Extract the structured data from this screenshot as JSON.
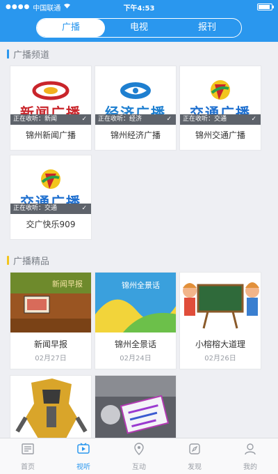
{
  "status_bar": {
    "signal_dots": "●●●●",
    "carrier": "中国联通",
    "time": "下午4:53",
    "battery_level": 0.9
  },
  "top_tabs": [
    {
      "label": "广播",
      "active": true
    },
    {
      "label": "电视",
      "active": false
    },
    {
      "label": "报刊",
      "active": false
    }
  ],
  "sections": {
    "channels_title": "广播频道",
    "programs_title": "广播精品"
  },
  "channels": [
    {
      "logo_text": "新闻广播",
      "strip_text": "正在收听：新闻",
      "name": "锦州新闻广播",
      "logo_color": "#c9252b",
      "icon": "news-broadcast-logo-icon"
    },
    {
      "logo_text": "经济广播",
      "strip_text": "正在收听：经济",
      "name": "锦州经济广播",
      "logo_color": "#1e7fd0",
      "icon": "economy-broadcast-logo-icon"
    },
    {
      "logo_text": "交通广播",
      "strip_text": "正在收听：交通",
      "name": "锦州交通广播",
      "logo_color": "#c9252b",
      "icon": "traffic-broadcast-logo-icon"
    },
    {
      "logo_text": "交通广播",
      "strip_text": "正在收听：交通",
      "name": "交广快乐909",
      "logo_color": "#1e6fcf",
      "icon": "traffic-broadcast-logo-icon"
    }
  ],
  "programs": [
    {
      "name": "新闻早报",
      "date": "02月27日",
      "thumb": "news-morning-thumb"
    },
    {
      "name": "锦州全景话",
      "date": "02月24日",
      "thumb": "landscape-thumb"
    },
    {
      "name": "小榕榕大道理",
      "date": "02月26日",
      "thumb": "kids-thumb"
    },
    {
      "name": "",
      "date": "",
      "thumb": "robot-thumb"
    },
    {
      "name": "",
      "date": "",
      "thumb": "sign-thumb"
    }
  ],
  "bottom_tabs": [
    {
      "label": "首页",
      "icon": "news-icon",
      "active": false
    },
    {
      "label": "视听",
      "icon": "media-icon",
      "active": true
    },
    {
      "label": "互动",
      "icon": "location-icon",
      "active": false
    },
    {
      "label": "发现",
      "icon": "compass-icon",
      "active": false
    },
    {
      "label": "我的",
      "icon": "user-icon",
      "active": false
    }
  ]
}
